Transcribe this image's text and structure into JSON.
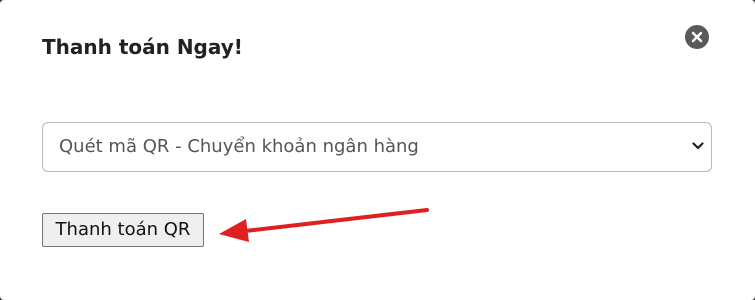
{
  "modal": {
    "title": "Thanh toán Ngay!",
    "close_icon": "close-circle-icon"
  },
  "payment_method": {
    "selected": "Quét mã QR - Chuyển khoản ngân hàng",
    "chevron_icon": "chevron-down-icon"
  },
  "actions": {
    "pay_qr_label": "Thanh toán QR"
  },
  "annotation": {
    "arrow_icon": "red-arrow-icon",
    "arrow_color": "#e02020"
  }
}
